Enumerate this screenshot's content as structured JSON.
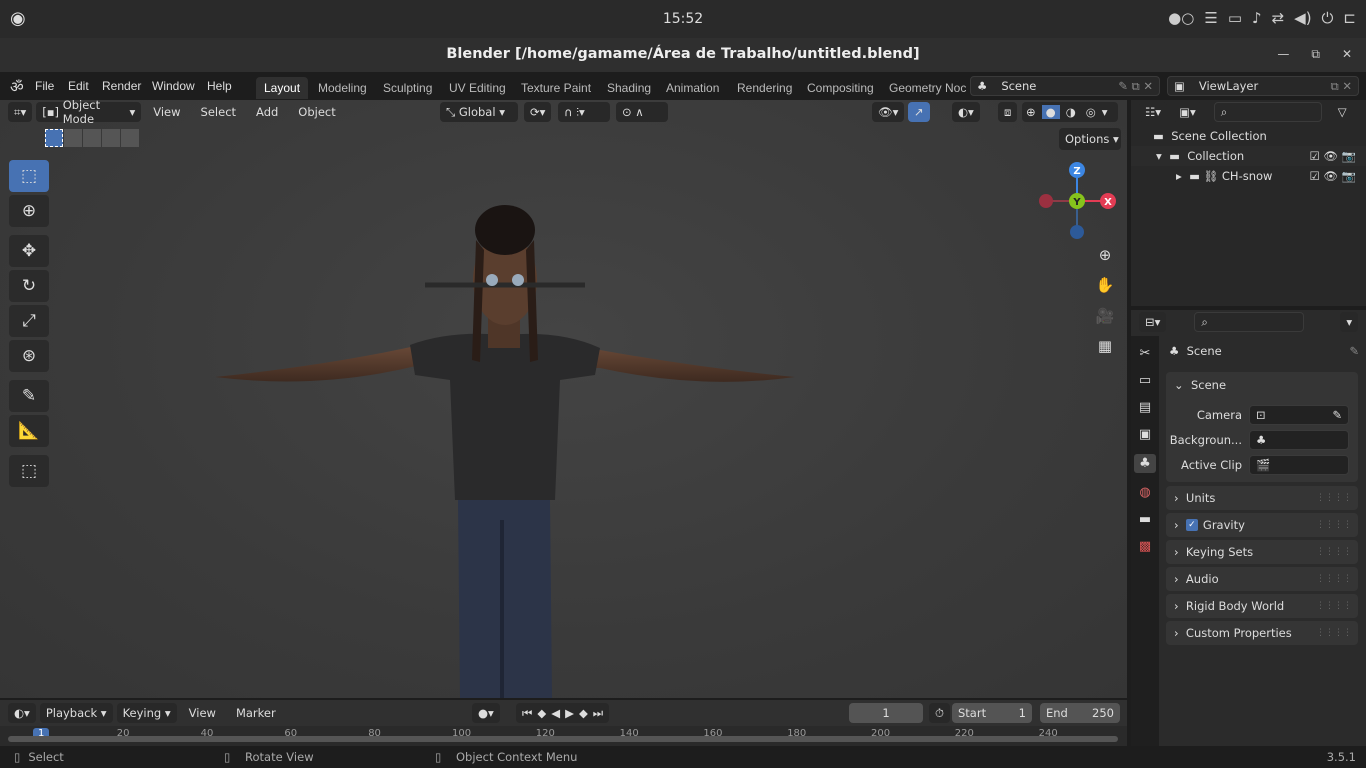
{
  "system": {
    "clock": "15:52"
  },
  "window": {
    "title": "Blender [/home/gamame/Área de Trabalho/untitled.blend]"
  },
  "menus": [
    "File",
    "Edit",
    "Render",
    "Window",
    "Help"
  ],
  "workspaces": [
    "Layout",
    "Modeling",
    "Sculpting",
    "UV Editing",
    "Texture Paint",
    "Shading",
    "Animation",
    "Rendering",
    "Compositing",
    "Geometry Noc"
  ],
  "scene": {
    "name": "Scene",
    "view_layer": "ViewLayer"
  },
  "viewport": {
    "mode": "Object Mode",
    "menus": [
      "View",
      "Select",
      "Add",
      "Object"
    ],
    "orientation": "Global",
    "options": "Options",
    "gizmo": {
      "z": "Z",
      "y": "Y",
      "x": "X"
    }
  },
  "outliner": {
    "items": [
      {
        "label": "Scene Collection"
      },
      {
        "label": "Collection"
      },
      {
        "label": "CH-snow"
      }
    ]
  },
  "properties": {
    "context": "Scene",
    "section": "Scene",
    "camera_label": "Camera",
    "background_label": "Backgroun...",
    "active_clip_label": "Active Clip",
    "panels": [
      "Units",
      "Gravity",
      "Keying Sets",
      "Audio",
      "Rigid Body World",
      "Custom Properties"
    ],
    "gravity_checked": true
  },
  "timeline": {
    "menus": [
      "Playback",
      "Keying",
      "View",
      "Marker"
    ],
    "current_frame": "1",
    "start_label": "Start",
    "start": "1",
    "end_label": "End",
    "end": "250",
    "ticks": [
      "1",
      "20",
      "40",
      "60",
      "80",
      "100",
      "120",
      "140",
      "160",
      "180",
      "200",
      "220",
      "240"
    ]
  },
  "status": {
    "select": "Select",
    "rotate": "Rotate View",
    "context_menu": "Object Context Menu",
    "version": "3.5.1"
  },
  "colors": {
    "accent": "#4772b3",
    "x_axis": "#e33c54",
    "y_axis": "#86c31c",
    "z_axis": "#3c86e3"
  }
}
